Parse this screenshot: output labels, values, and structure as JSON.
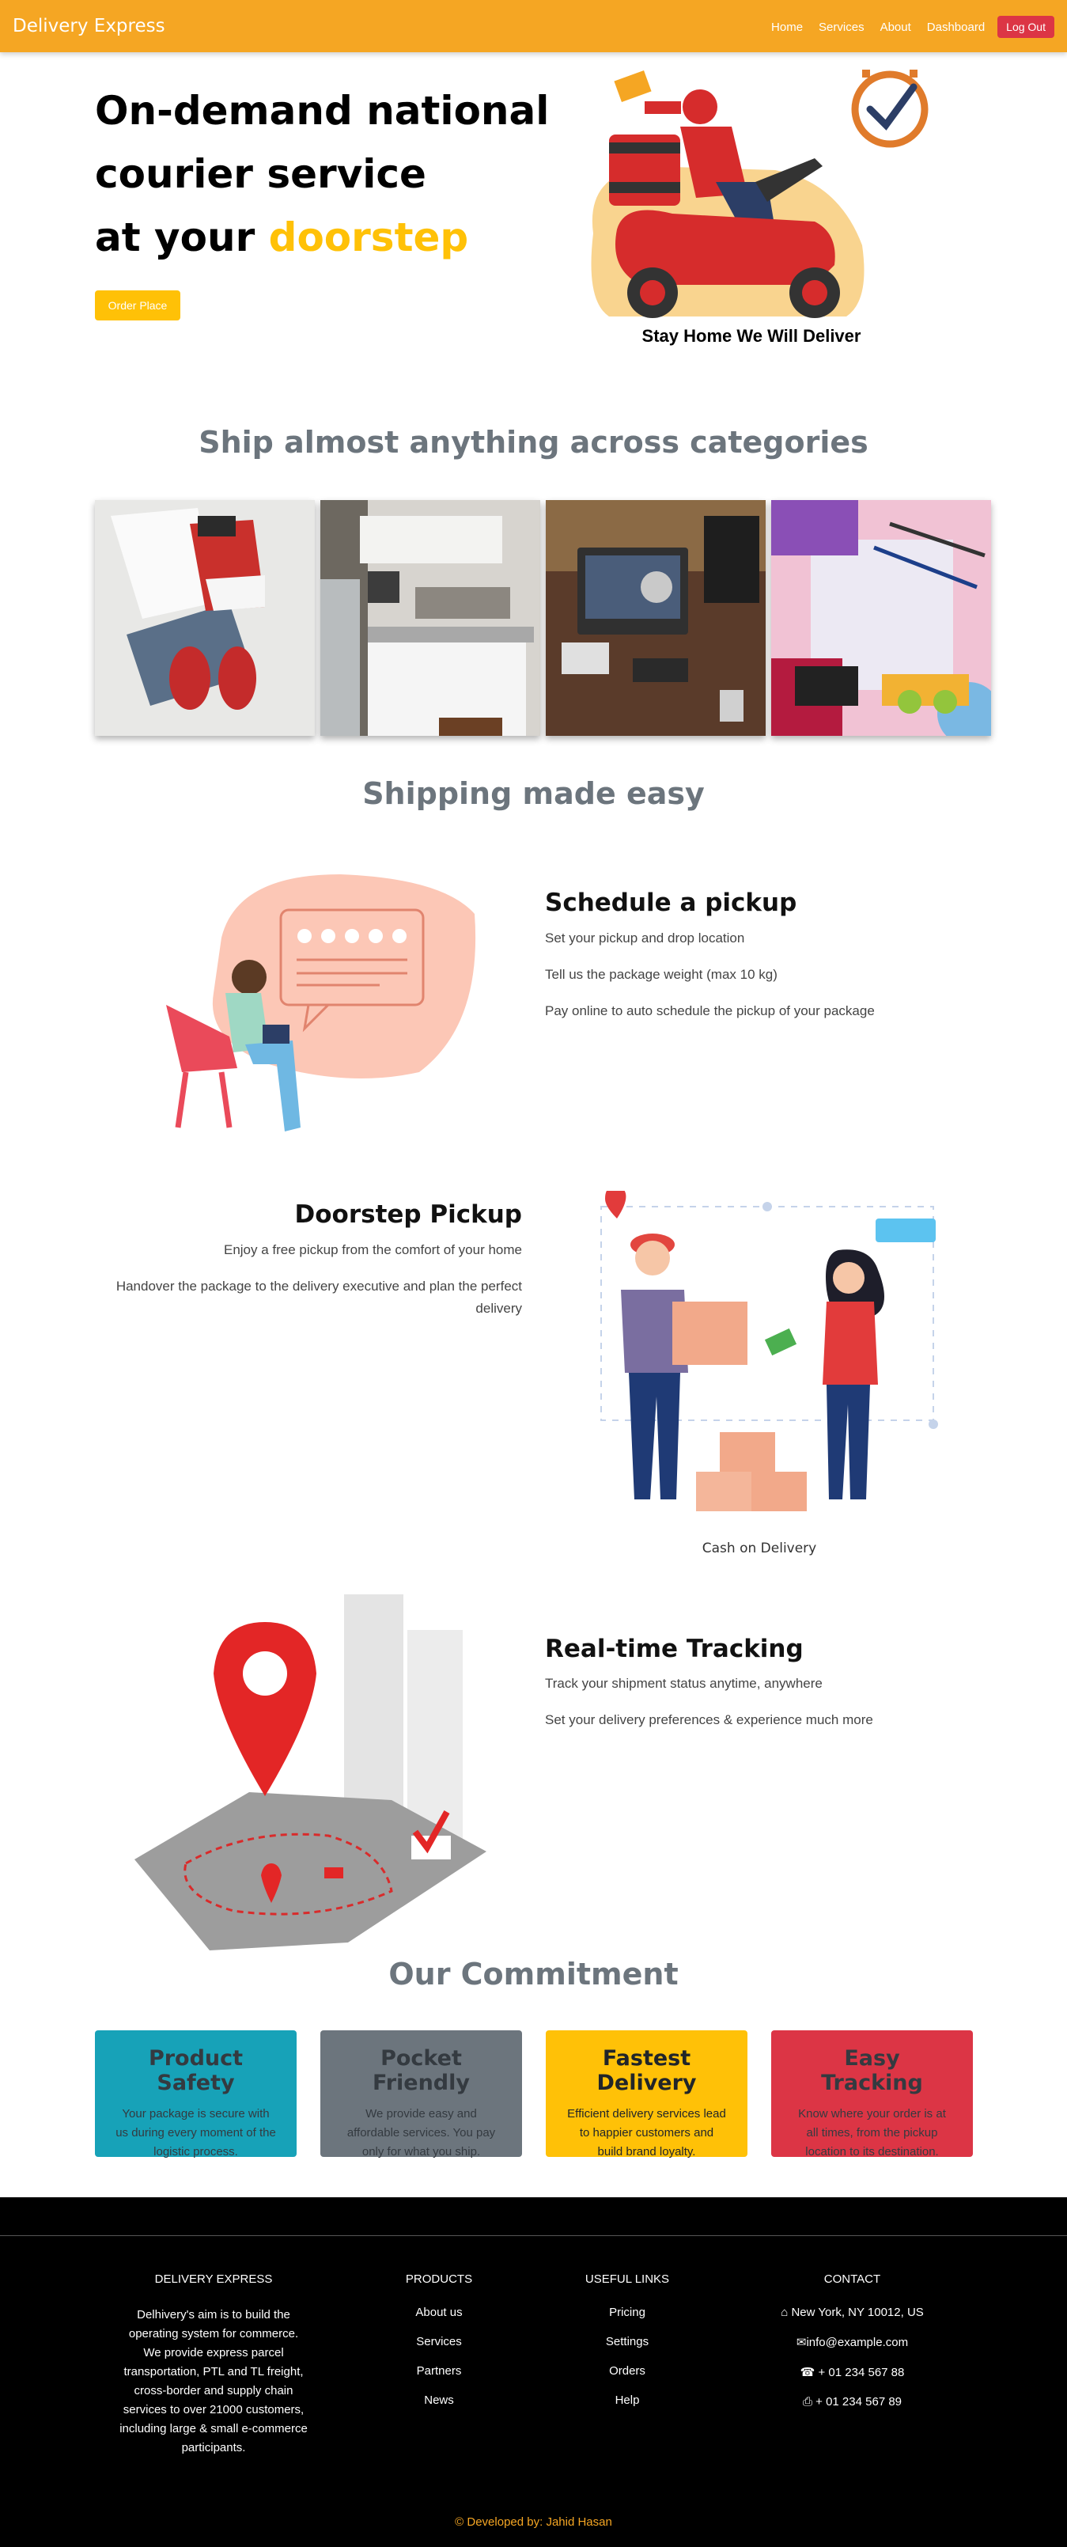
{
  "navbar": {
    "brand": "Delivery Express",
    "links": [
      "Home",
      "Services",
      "About",
      "Dashboard"
    ],
    "logout": "Log Out"
  },
  "hero": {
    "line1": "On-demand national",
    "line2": "courier service",
    "line3_prefix": "at your ",
    "line3_accent": "doorstep",
    "button": "Order Place",
    "caption": "Stay Home We Will Deliver"
  },
  "categories": {
    "title": "Ship almost anything across categories",
    "images": [
      "clothing",
      "kitchen",
      "electronics",
      "stationery"
    ]
  },
  "shipping": {
    "title": "Shipping made easy",
    "schedule": {
      "title": "Schedule a pickup",
      "lines": [
        "Set your pickup and drop location",
        "Tell us the package weight (max 10 kg)",
        "Pay online to auto schedule the pickup of your package"
      ]
    },
    "doorstep": {
      "title": "Doorstep Pickup",
      "lines": [
        "Enjoy a free pickup from the comfort of your home",
        "Handover the package to the delivery executive and plan the perfect delivery"
      ],
      "image_caption": "Cash on Delivery"
    },
    "tracking": {
      "title": "Real-time Tracking",
      "lines": [
        "Track your shipment status anytime, anywhere",
        "Set your delivery preferences & experience much more"
      ]
    }
  },
  "commitment": {
    "title": "Our Commitment",
    "cards": [
      {
        "title": "Product Safety",
        "text": "Your package is secure with us during every moment of the logistic process.",
        "color": "#17a2b8"
      },
      {
        "title": "Pocket Friendly",
        "text": "We provide easy and affordable services. You pay only for what you ship.",
        "color": "#6c757d"
      },
      {
        "title": "Fastest Delivery",
        "text": "Efficient delivery services lead to happier customers and build brand loyalty.",
        "color": "#ffc107"
      },
      {
        "title": "Easy Tracking",
        "text": "Know where your order is at all times, from the pickup location to its destination.",
        "color": "#dc3545"
      }
    ]
  },
  "footer": {
    "about_title": "DELIVERY EXPRESS",
    "about_text": "Delhivery's aim is to build the operating system for commerce. We provide express parcel transportation, PTL and TL freight, cross-border and supply chain services to over 21000 customers, including large & small e-commerce participants.",
    "products_title": "PRODUCTS",
    "products": [
      "About us",
      "Services",
      "Partners",
      "News"
    ],
    "useful_title": "USEFUL LINKS",
    "useful": [
      "Pricing",
      "Settings",
      "Orders",
      "Help"
    ],
    "contact_title": "CONTACT",
    "contact": [
      {
        "icon": "home-icon",
        "text": "New York, NY 10012, US"
      },
      {
        "icon": "envelope-icon",
        "text": "info@example.com"
      },
      {
        "icon": "phone-icon",
        "text": "+ 01 234 567 88"
      },
      {
        "icon": "printer-icon",
        "text": "+ 01 234 567 89"
      }
    ],
    "credit": "© Developed by: Jahid Hasan"
  }
}
